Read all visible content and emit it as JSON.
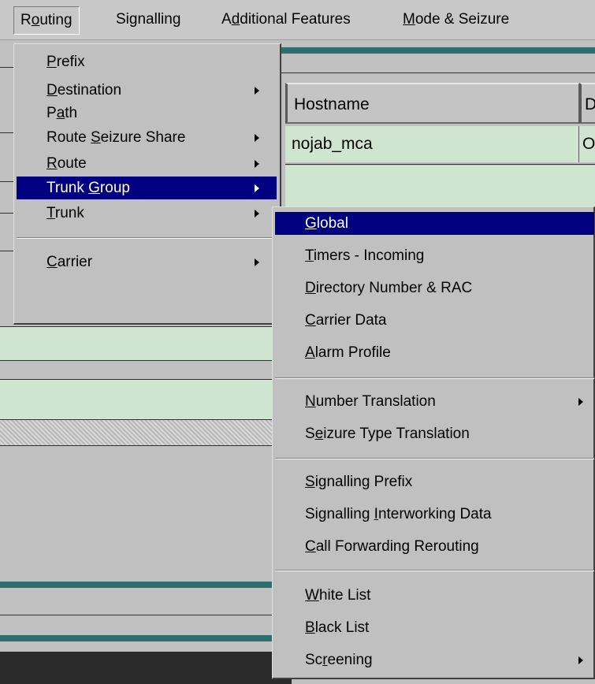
{
  "menubar": {
    "items": [
      {
        "label": "Routing",
        "open": true
      },
      {
        "label": "Signalling"
      },
      {
        "label": "Additional Features"
      },
      {
        "label": "Mode & Seizure"
      }
    ]
  },
  "grid": {
    "headers": [
      "Hostname",
      "D"
    ],
    "row1": [
      "nojab_mca",
      "O"
    ]
  },
  "routing_menu": {
    "items": [
      {
        "label": "Prefix",
        "mn": "P",
        "submenu": false
      },
      {
        "label": "Destination",
        "mn": "D",
        "submenu": true
      },
      {
        "label": "Path",
        "mn": "a",
        "submenu": false
      },
      {
        "label": "Route Seizure Share",
        "mn": "S",
        "submenu": true
      },
      {
        "label": "Route",
        "mn": "R",
        "submenu": true
      },
      {
        "label": "Trunk Group",
        "mn": "G",
        "submenu": true,
        "selected": true
      },
      {
        "label": "Trunk",
        "mn": "T",
        "submenu": true
      },
      {
        "label": "Carrier",
        "mn": "C",
        "submenu": true
      }
    ]
  },
  "trunk_group_menu": {
    "items": [
      {
        "label": "Global",
        "mn": "G",
        "selected": true
      },
      {
        "label": "Timers - Incoming",
        "mn": "T"
      },
      {
        "label": "Directory Number & RAC",
        "mn": "D"
      },
      {
        "label": "Carrier Data",
        "mn": "C"
      },
      {
        "label": "Alarm Profile",
        "mn": "A"
      },
      {
        "label": "Number Translation",
        "mn": "N",
        "submenu": true
      },
      {
        "label": "Seizure Type Translation",
        "mn": "e"
      },
      {
        "label": "Signalling Prefix",
        "mn": "S"
      },
      {
        "label": "Signalling Interworking Data",
        "mn": "I"
      },
      {
        "label": "Call Forwarding Rerouting",
        "mn": "C"
      },
      {
        "label": "White List",
        "mn": "W"
      },
      {
        "label": "Black List",
        "mn": "B"
      },
      {
        "label": "Screening",
        "mn": "r",
        "submenu": true
      }
    ]
  }
}
